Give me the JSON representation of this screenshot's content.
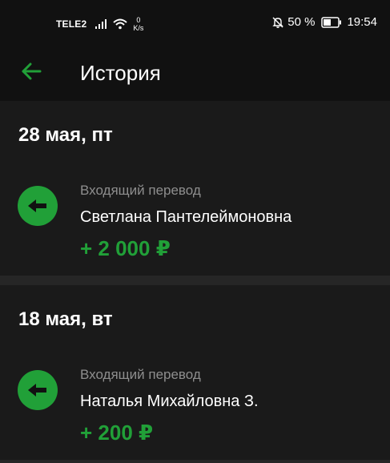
{
  "status_bar": {
    "carrier": "TELE2",
    "net_speed_value": "0",
    "net_speed_unit": "K/s",
    "battery_percent": "50 %",
    "time": "19:54"
  },
  "app_bar": {
    "title": "История"
  },
  "sections": [
    {
      "date": "28 мая, пт",
      "transactions": [
        {
          "type": "Входящий перевод",
          "name": "Светлана Пантелеймоновна",
          "amount": "+ 2 000 ₽"
        }
      ]
    },
    {
      "date": "18 мая, вт",
      "transactions": [
        {
          "type": "Входящий перевод",
          "name": "Наталья Михайловна З.",
          "amount": "+ 200 ₽"
        }
      ]
    }
  ],
  "colors": {
    "accent_green": "#21a038",
    "background": "#111111",
    "card": "#1a1a1a",
    "secondary_text": "#8e8e8e"
  },
  "icons": {
    "back": "arrow-left-icon",
    "incoming": "incoming-transfer-icon"
  }
}
